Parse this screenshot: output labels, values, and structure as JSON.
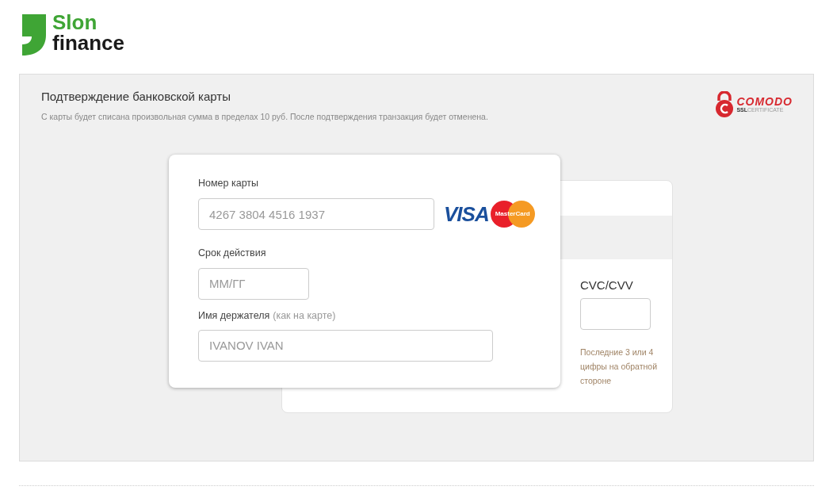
{
  "logo": {
    "line_1": "Slon",
    "line_2": "finance"
  },
  "panel": {
    "title": "Подтверждение банковской карты",
    "subtitle": "С карты будет списана произвольная сумма в пределах 10 руб. После подтверждения транзакция будет отменена.",
    "seal": {
      "name": "COMODO",
      "ssl": "SSL",
      "certificate": "CERTIFICATE"
    }
  },
  "front": {
    "card_number": {
      "label": "Номер карты",
      "placeholder": "4267 3804 4516 1937"
    },
    "brands": {
      "visa": "VISA",
      "mastercard": "MasterCard"
    },
    "expiry": {
      "label": "Срок действия",
      "placeholder": "ММ/ГГ"
    },
    "holder": {
      "label": "Имя держателя",
      "note": "(как на карте)",
      "placeholder": "IVANOV IVAN"
    }
  },
  "back": {
    "cvc": {
      "label": "CVC/CVV",
      "hint": "Последние 3 или 4 цифры на обратной стороне"
    }
  }
}
